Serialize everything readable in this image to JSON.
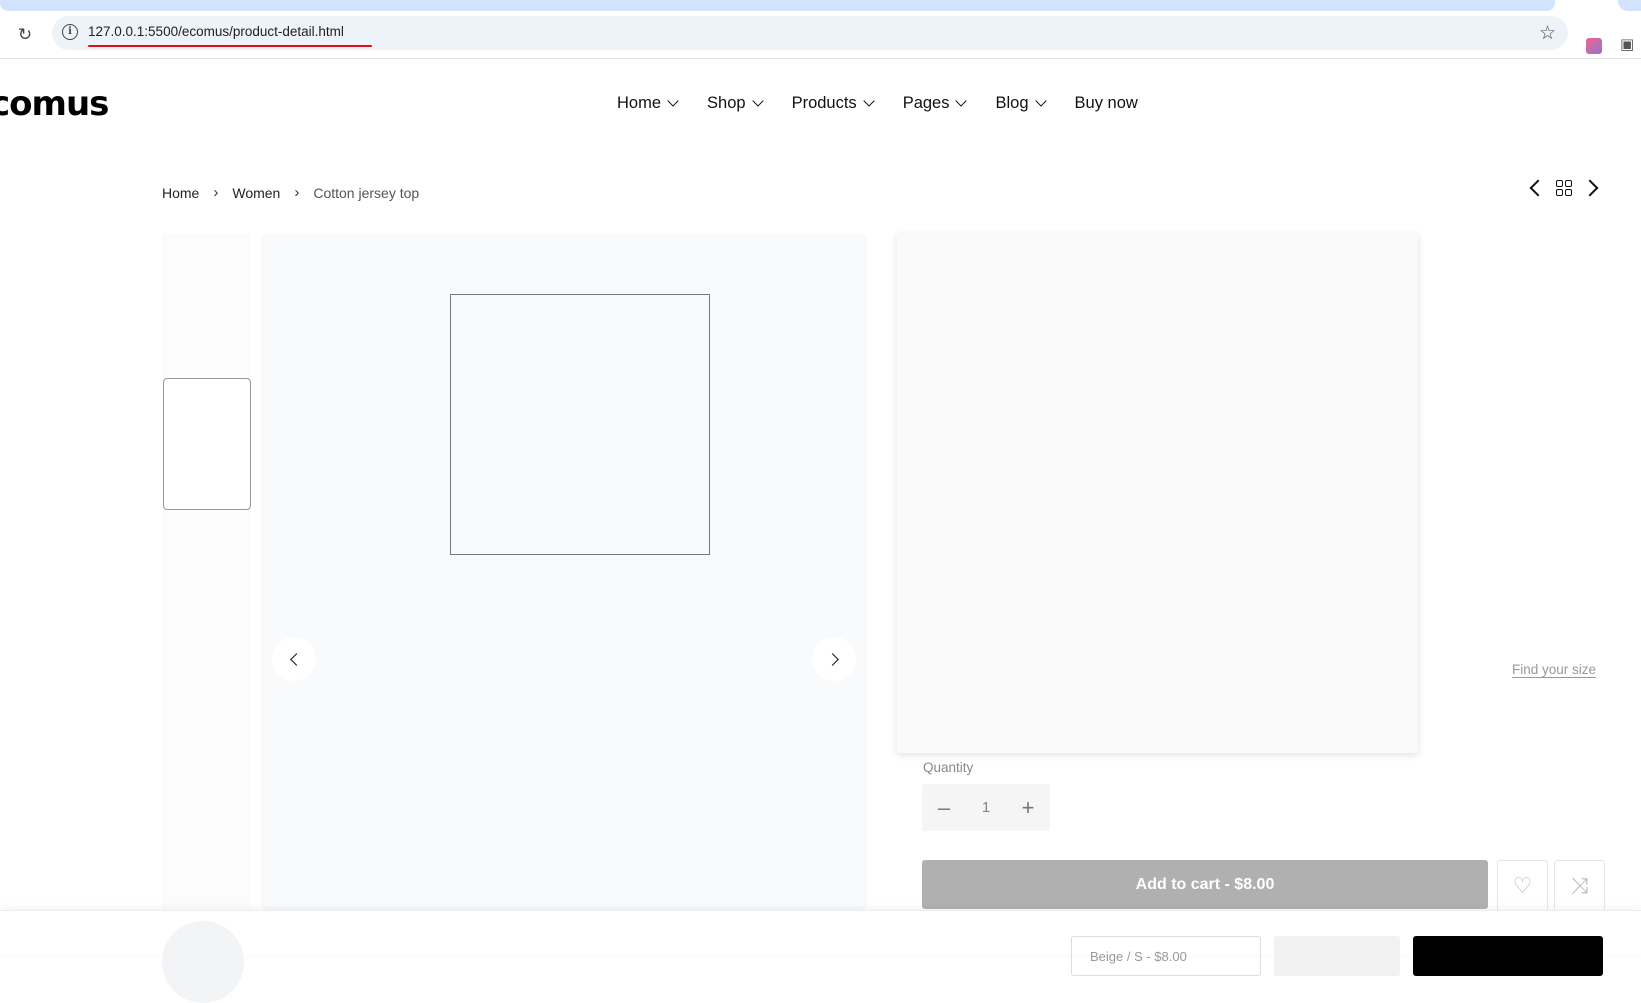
{
  "browser": {
    "url": "127.0.0.1:5500/ecomus/product-detail.html"
  },
  "site": {
    "logo": "comus",
    "nav": [
      {
        "label": "Home",
        "has_dropdown": true
      },
      {
        "label": "Shop",
        "has_dropdown": true
      },
      {
        "label": "Products",
        "has_dropdown": true
      },
      {
        "label": "Pages",
        "has_dropdown": true
      },
      {
        "label": "Blog",
        "has_dropdown": true
      },
      {
        "label": "Buy now",
        "has_dropdown": false
      }
    ]
  },
  "breadcrumb": {
    "items": [
      "Home",
      "Women"
    ],
    "separator": "›",
    "current": "Cotton jersey top"
  },
  "product": {
    "find_size": "Find your size",
    "quantity_label": "Quantity",
    "quantity_value": "1",
    "add_to_cart": "Add to cart - $8.00"
  },
  "sticky": {
    "select_value": "Beige / S - $8.00"
  },
  "icons": {
    "reload": "reload-icon",
    "info": "info-icon",
    "star": "star-icon",
    "wishlist": "heart-icon",
    "compare": "shuffle-icon"
  },
  "colors": {
    "tab_accent": "#d3e3fd",
    "url_underline": "#e0101a",
    "add_to_cart_bg": "#b0b0b0",
    "buy_button_bg": "#000000"
  }
}
